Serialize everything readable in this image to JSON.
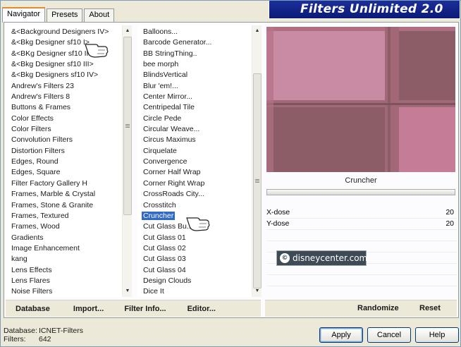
{
  "banner": {
    "title": "Filters Unlimited 2.0"
  },
  "tabs": [
    {
      "label": "Navigator",
      "active": true
    },
    {
      "label": "Presets",
      "active": false
    },
    {
      "label": "About",
      "active": false
    }
  ],
  "categories": {
    "items": [
      "&<Background Designers IV>",
      "&<Bkg Designer sf10 I>",
      "&<BKg Designer sf10 II>",
      "&<Bkg Designer sf10 III>",
      "&<Bkg Designers sf10 IV>",
      "Andrew's Filters 23",
      "Andrew's Filters 8",
      "Buttons & Frames",
      "Color Effects",
      "Color Filters",
      "Convolution Filters",
      "Distortion Filters",
      "Edges, Round",
      "Edges, Square",
      "Filter Factory Gallery H",
      "Frames, Marble & Crystal",
      "Frames, Stone & Granite",
      "Frames, Textured",
      "Frames, Wood",
      "Gradients",
      "Image Enhancement",
      "kang",
      "Lens Effects",
      "Lens Flares",
      "Noise Filters"
    ]
  },
  "filters": {
    "selected": "Cruncher",
    "items": [
      "Balloons...",
      "Barcode Generator...",
      "BB StringThing..",
      "bee morph",
      "BlindsVertical",
      "Blur 'em!...",
      "Center Mirror...",
      "Centripedal Tile",
      "Circle Pede",
      "Circular Weave...",
      "Circus Maximus",
      "Cirquelate",
      "Convergence",
      "Corner Half Wrap",
      "Corner Right Wrap",
      "CrossRoads City...",
      "Crosstitch",
      "Cruncher",
      "Cut Glass  Bu...",
      "Cut Glass 01",
      "Cut Glass 02",
      "Cut Glass 03",
      "Cut Glass 04",
      "Design Clouds",
      "Dice It"
    ]
  },
  "toolbar": {
    "database": "Database",
    "import": "Import...",
    "filter_info": "Filter Info...",
    "editor": "Editor...",
    "randomize": "Randomize",
    "reset": "Reset"
  },
  "preview": {
    "filter_name": "Cruncher",
    "colors": {
      "base": "#c47c97",
      "dark": "#8c5d66",
      "mid": "#9f6676",
      "line": "#b06e83"
    }
  },
  "params": [
    {
      "label": "X-dose",
      "value": "20"
    },
    {
      "label": "Y-dose",
      "value": "20"
    }
  ],
  "watermark": {
    "text": "disneycenter.com"
  },
  "footer": {
    "database_label": "Database:",
    "database_value": "ICNET-Filters",
    "filters_label": "Filters:",
    "filters_value": "642",
    "apply": "Apply",
    "cancel": "Cancel",
    "help": "Help"
  }
}
